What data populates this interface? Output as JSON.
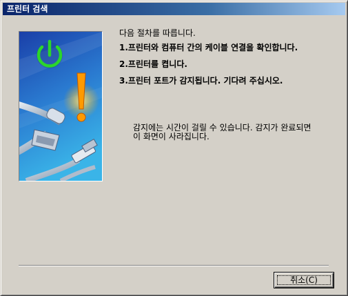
{
  "window": {
    "title": "프린터 검색"
  },
  "content": {
    "intro": "다음 절차를 따릅니다.",
    "steps": [
      "1.프린터와 컴퓨터 간의 케이블 연결을 확인합니다.",
      "2.프린터를 켭니다.",
      "3.프린터 포트가 감지됩니다. 기다려 주십시오."
    ],
    "note_line1": "감지에는 시간이 걸릴 수 있습니다. 감지가 완료되면",
    "note_line2": "이 화면이 사라집니다."
  },
  "buttons": {
    "cancel_label": "취소(C)"
  },
  "illustration": {
    "icons": [
      "power-icon",
      "warning-exclamation-icon",
      "usb-cable-icon"
    ],
    "colors": {
      "panel_top": "#1a3fa8",
      "panel_bottom": "#3ab4e8",
      "power_green": "#2bd62b",
      "exclamation": "#ff9a00"
    }
  }
}
